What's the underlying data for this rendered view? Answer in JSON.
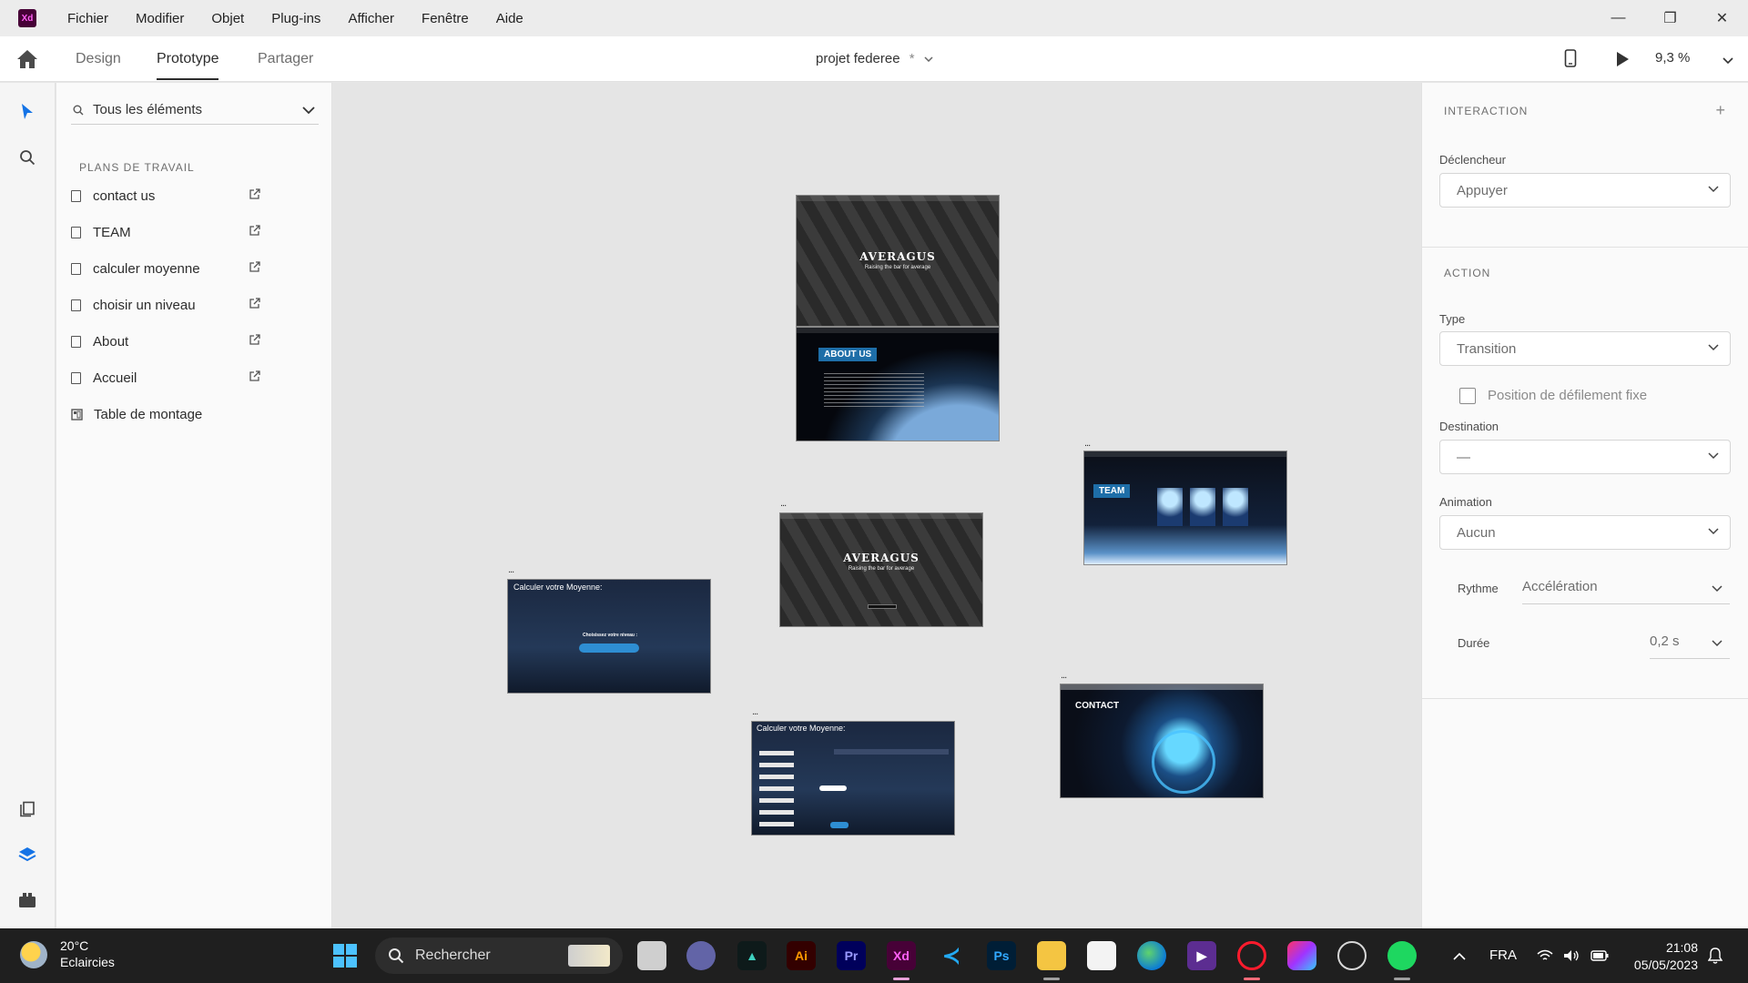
{
  "app": {
    "logo": "Xd",
    "accent": "#470137"
  },
  "menu": [
    "Fichier",
    "Modifier",
    "Objet",
    "Plug-ins",
    "Afficher",
    "Fenêtre",
    "Aide"
  ],
  "window_controls": {
    "minimize": "—",
    "restore": "❐",
    "close": "✕"
  },
  "modes": [
    "Design",
    "Prototype",
    "Partager"
  ],
  "active_mode": "Prototype",
  "document": {
    "title": "projet federee",
    "modified": "*"
  },
  "zoom": "9,3 %",
  "layers": {
    "search_label": "Tous les éléments",
    "section_title": "PLANS DE TRAVAIL",
    "artboards": [
      "contact us",
      "TEAM",
      "calculer moyenne",
      "choisir un niveau",
      "About",
      "Accueil"
    ],
    "board_table": "Table de montage"
  },
  "canvas": {
    "boards": {
      "accueil_title": "AVERAGUS",
      "accueil_sub": "Raising the bar for average",
      "about_tag": "ABOUT US",
      "home_title": "AVERAGUS",
      "home_sub": "Raising the bar for average",
      "team_tag": "TEAM",
      "calc1_title": "Calculer votre Moyenne:",
      "calc1_prompt": "Choisissez votre niveau :",
      "calc2_title": "Calculer votre Moyenne:",
      "contact_tag": "CONTACT",
      "dots": "..."
    }
  },
  "interaction": {
    "heading": "INTERACTION",
    "add": "+",
    "trigger_label": "Déclencheur",
    "trigger_value": "Appuyer"
  },
  "action": {
    "heading": "ACTION",
    "type_label": "Type",
    "type_value": "Transition",
    "fixed_scroll_label": "Position de défilement fixe",
    "fixed_scroll_checked": false,
    "destination_label": "Destination",
    "destination_value": "—",
    "animation_label": "Animation",
    "animation_value": "Aucun",
    "easing_label": "Rythme",
    "easing_value": "Accélération",
    "duration_label": "Durée",
    "duration_value": "0,2 s"
  },
  "taskbar": {
    "weather_temp": "20°C",
    "weather_desc": "Eclaircies",
    "search_placeholder": "Rechercher",
    "language": "FRA",
    "time": "21:08",
    "date": "05/05/2023",
    "apps": [
      "windows-start",
      "search",
      "widgets",
      "file-explorer-window",
      "teams-chat",
      "affinity",
      "illustrator",
      "premiere-pro",
      "xd",
      "vscode",
      "photoshop",
      "file-explorer",
      "microsoft-store",
      "edge",
      "visual-studio",
      "opera",
      "creative-cloud",
      "obs",
      "spotify"
    ]
  }
}
